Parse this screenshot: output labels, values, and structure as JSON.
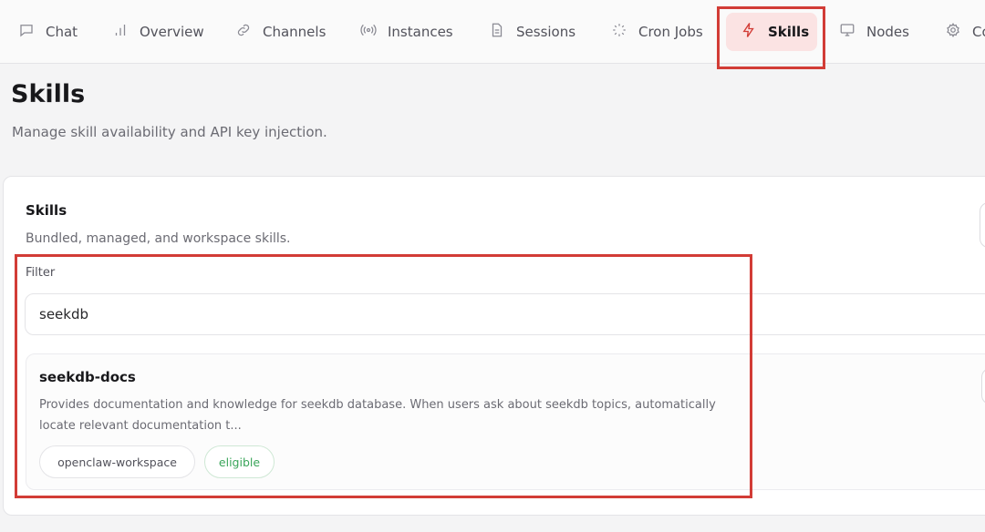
{
  "nav": {
    "items": [
      {
        "label": "Chat",
        "icon": "chat-bubble-icon"
      },
      {
        "label": "Overview",
        "icon": "bar-chart-icon"
      },
      {
        "label": "Channels",
        "icon": "link-icon"
      },
      {
        "label": "Instances",
        "icon": "radio-icon"
      },
      {
        "label": "Sessions",
        "icon": "document-icon"
      },
      {
        "label": "Cron Jobs",
        "icon": "loader-icon"
      },
      {
        "label": "Skills",
        "icon": "lightning-icon",
        "active": true
      },
      {
        "label": "Nodes",
        "icon": "monitor-icon"
      },
      {
        "label": "Co",
        "icon": "gear-icon"
      }
    ]
  },
  "page": {
    "title": "Skills",
    "subtitle": "Manage skill availability and API key injection."
  },
  "card": {
    "title": "Skills",
    "subtitle": "Bundled, managed, and workspace skills.",
    "filter_label": "Filter",
    "filter_value": "seekdb"
  },
  "skills": [
    {
      "name": "seekdb-docs",
      "description": "Provides documentation and knowledge for seekdb database. When users ask about seekdb topics, automatically locate relevant documentation t...",
      "source": "openclaw-workspace",
      "status": "eligible"
    }
  ],
  "colors": {
    "accent": "#d23c36",
    "active_tab_bg": "#fbe3e3",
    "eligible": "#3aa55a"
  }
}
